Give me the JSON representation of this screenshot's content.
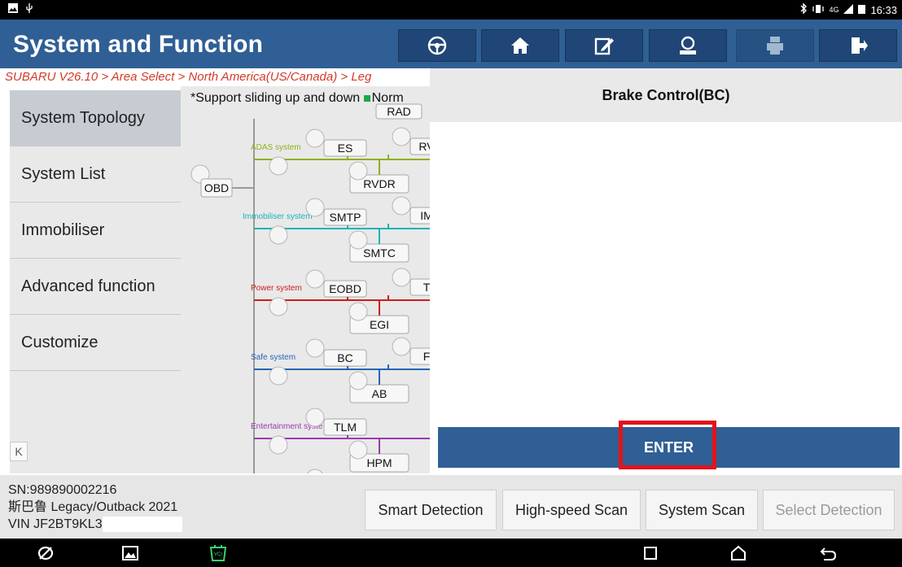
{
  "status_bar": {
    "time": "16:33",
    "signal": "4G"
  },
  "header": {
    "title": "System and Function",
    "icons": [
      "steering-wheel-icon",
      "home-icon",
      "edit-icon",
      "support-icon",
      "print-icon",
      "exit-icon"
    ]
  },
  "breadcrumb": "SUBARU V26.10 > Area Select > North America(US/Canada) > Leg",
  "sidebar": {
    "items": [
      {
        "label": "System Topology"
      },
      {
        "label": "System List"
      },
      {
        "label": "Immobiliser"
      },
      {
        "label": "Advanced function"
      },
      {
        "label": "Customize"
      }
    ],
    "collapse_label": "K"
  },
  "topology": {
    "hint": "*Support sliding up and down",
    "hint_legend": "Norm",
    "root": "OBD",
    "top_partial": "RAD",
    "groups": [
      {
        "name": "ADAS system",
        "color": "#8fb020",
        "nodes": [
          "ES",
          "RVDR"
        ],
        "partial": "RV"
      },
      {
        "name": "Immobiliser system",
        "color": "#1bb3b8",
        "nodes": [
          "SMTP",
          "SMTC"
        ],
        "partial": "IM"
      },
      {
        "name": "Power system",
        "color": "#d11a1a",
        "nodes": [
          "EOBD",
          "EGI"
        ],
        "partial": "T"
      },
      {
        "name": "Safe system",
        "color": "#2466b6",
        "nodes": [
          "BC",
          "AB"
        ],
        "partial": "F"
      },
      {
        "name": "Entertainment syste",
        "color": "#9b3ab0",
        "nodes": [
          "TLM",
          "HPM"
        ],
        "partial": ""
      }
    ]
  },
  "panel": {
    "title": "Brake Control(BC)",
    "enter_label": "ENTER"
  },
  "vehicle": {
    "sn": "SN:989890002216",
    "model": "斯巴鲁 Legacy/Outback 2021",
    "vin": "VIN JF2BT9KL3"
  },
  "actions": [
    {
      "label": "Smart Detection",
      "enabled": true
    },
    {
      "label": "High-speed Scan",
      "enabled": true
    },
    {
      "label": "System Scan",
      "enabled": true
    },
    {
      "label": "Select Detection",
      "enabled": false
    }
  ],
  "colors": {
    "accent": "#2f5f94",
    "breadcrumb": "#d23b2a",
    "highlight": "#e3141a"
  }
}
